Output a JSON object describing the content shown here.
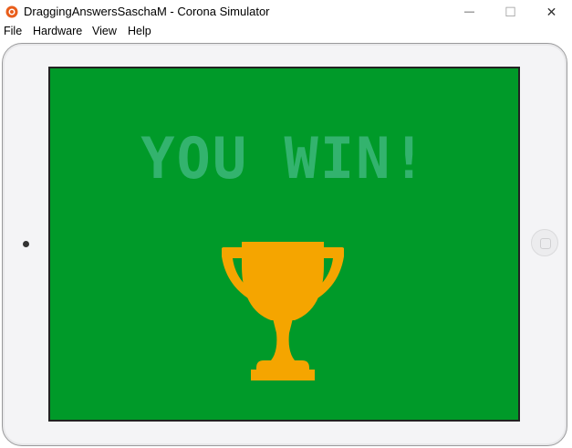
{
  "window": {
    "title": "DraggingAnswersSaschaM - Corona Simulator",
    "minimize_glyph": "—",
    "maximize_glyph": "☐",
    "close_glyph": "✕"
  },
  "menu": {
    "items": [
      {
        "label": "File"
      },
      {
        "label": "Hardware"
      },
      {
        "label": "View"
      },
      {
        "label": "Help"
      }
    ]
  },
  "screen": {
    "headline": "YOU WIN!",
    "background_color": "#009a29",
    "headline_color": "#3cb87b",
    "trophy_color": "#f5a500",
    "icon": "trophy-icon"
  }
}
